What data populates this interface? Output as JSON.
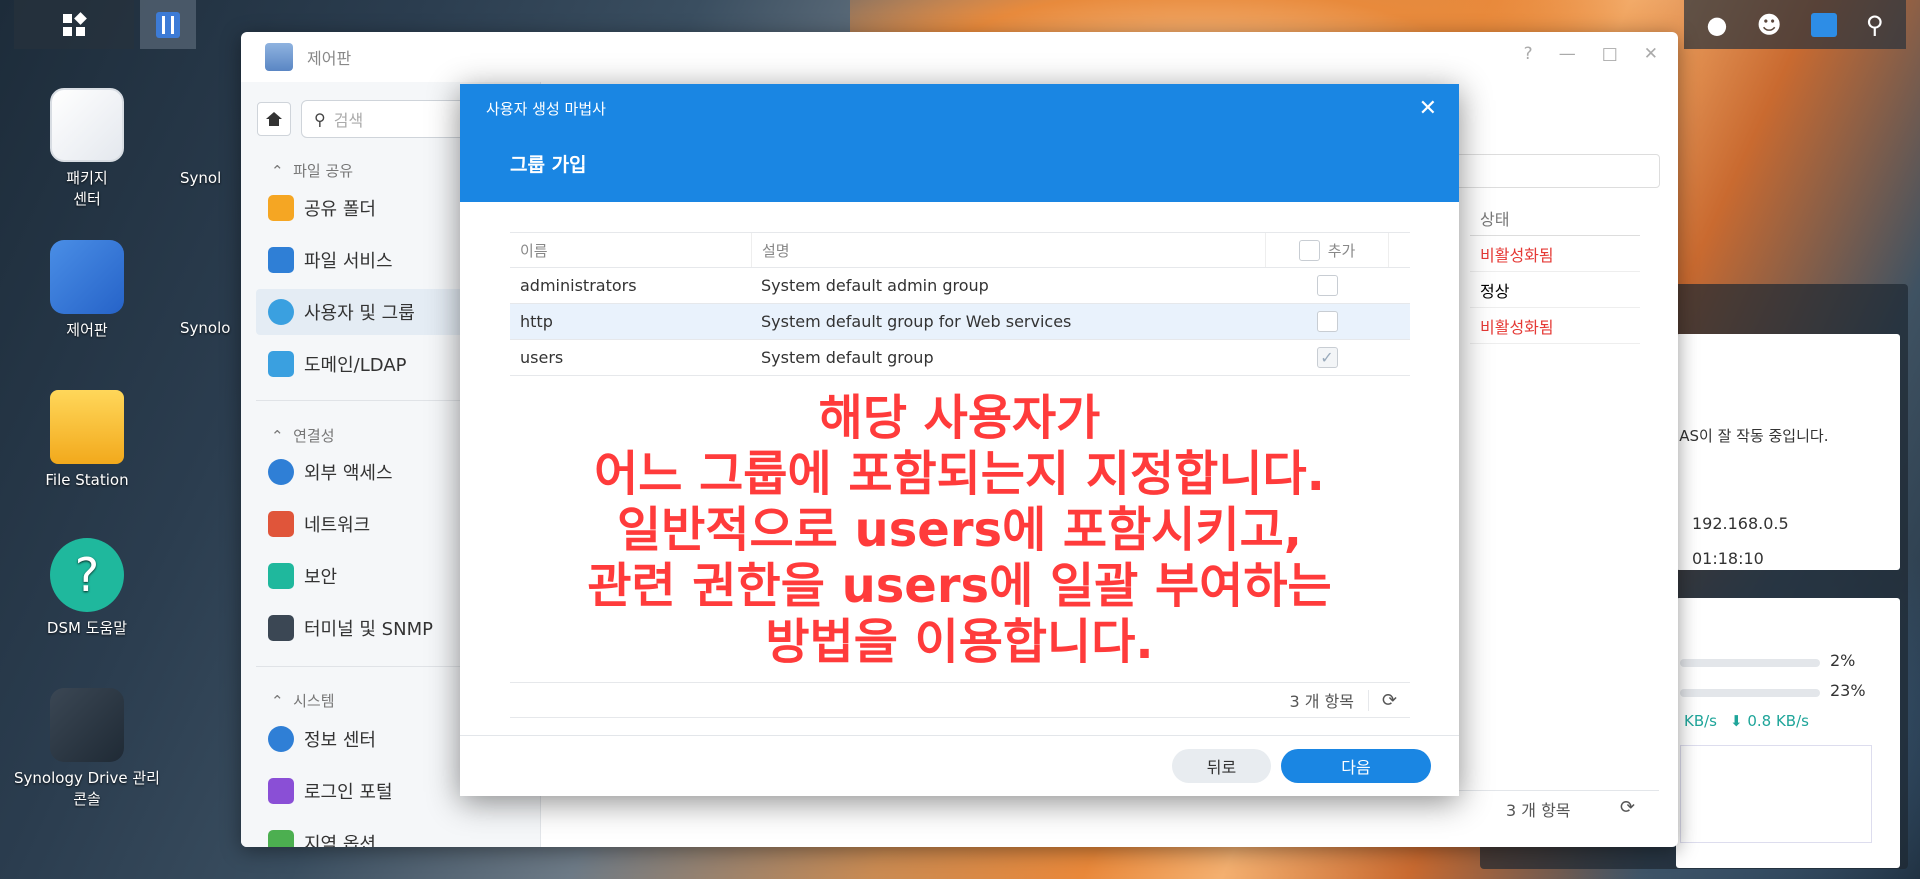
{
  "desktop": {
    "icons": [
      {
        "label": "패키지\n센터",
        "name": "package-center"
      },
      {
        "label": "제어판",
        "name": "control-panel"
      },
      {
        "label": "File Station",
        "name": "file-station"
      },
      {
        "label": "DSM 도움말",
        "name": "dsm-help"
      },
      {
        "label": "Synology Drive 관리\n콘솔",
        "name": "synology-drive-admin"
      }
    ],
    "partial_labels": [
      "Synol",
      "Synolo"
    ]
  },
  "control_panel": {
    "title": "제어판",
    "search_placeholder": "검색",
    "sections": [
      {
        "title": "파일 공유",
        "items": [
          "공유 폴더",
          "파일 서비스",
          "사용자 및 그룹",
          "도메인/LDAP"
        ]
      },
      {
        "title": "연결성",
        "items": [
          "외부 액세스",
          "네트워크",
          "보안",
          "터미널 및 SNMP"
        ]
      },
      {
        "title": "시스템",
        "items": [
          "정보 센터",
          "로그인 포털",
          "지역 옵션"
        ]
      }
    ],
    "active_item": "사용자 및 그룹",
    "table": {
      "header_status": "상태",
      "rows": [
        "비활성화됨",
        "정상",
        "비활성화됨"
      ]
    },
    "footer_count": "3 개 항목"
  },
  "widget": {
    "status_text": "NAS이 잘 작동 중입니다.",
    "ip": "192.168.0.5",
    "uptime": "01:18:10",
    "cpu": "2%",
    "ram": "23%",
    "upload": "KB/s",
    "download": "0.8 KB/s"
  },
  "wizard": {
    "subtitle": "사용자 생성 마법사",
    "title": "그룹 가입",
    "columns": {
      "name": "이름",
      "desc": "설명",
      "add": "추가"
    },
    "rows": [
      {
        "name": "administrators",
        "desc": "System default admin group",
        "checked": false
      },
      {
        "name": "http",
        "desc": "System default group for Web services",
        "checked": false
      },
      {
        "name": "users",
        "desc": "System default group",
        "checked": true
      }
    ],
    "count": "3 개 항목",
    "back_label": "뒤로",
    "next_label": "다음"
  },
  "annotation": {
    "lines": [
      "해당 사용자가",
      "어느 그룹에 포함되는지 지정합니다.",
      "일반적으로 users에 포함시키고,",
      "관련 권한을 users에 일괄 부여하는",
      "방법을 이용합니다."
    ]
  },
  "colors": {
    "accent": "#1a86e3",
    "annotation": "#ff3b3b",
    "status_disabled": "#e53935"
  }
}
